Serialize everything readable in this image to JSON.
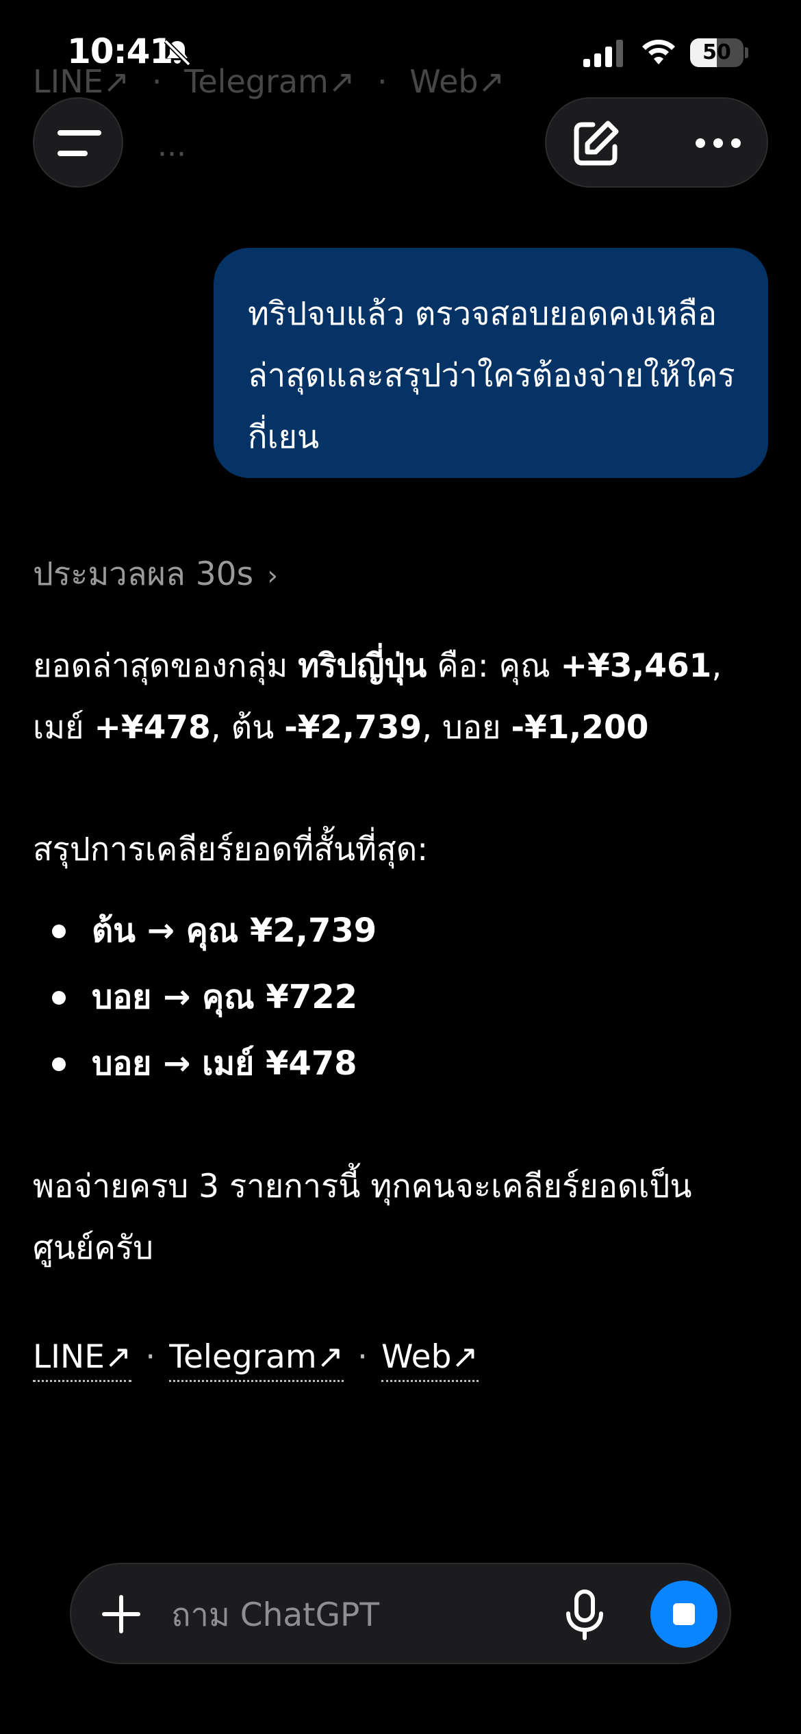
{
  "status_bar": {
    "time": "10:41",
    "battery_percent": 50,
    "battery_label": "50",
    "icons": [
      "bell-slash-icon",
      "cellular-signal-icon",
      "wifi-icon",
      "battery-icon"
    ]
  },
  "ghost_links": {
    "line": "LINE↗",
    "telegram": "Telegram↗",
    "web": "Web↗",
    "separator": "·",
    "more": "···"
  },
  "header": {
    "icons": [
      "menu-icon",
      "edit-icon",
      "more-dots-icon"
    ]
  },
  "user_message": {
    "text": "ทริปจบแล้ว ตรวจสอบยอดคงเหลือล่าสุดและสรุปว่าใครต้องจ่ายให้ใครกี่เยน",
    "bubble_color": "#053366"
  },
  "thinking": {
    "label": "ประมวลผล 30s",
    "chevron": "›"
  },
  "answer": {
    "p1_prefix": "ยอดล่าสุดของกลุ่ม ",
    "p1_group": "ทริปญี่ปุ่น",
    "p1_kue": " คือ: คุณ ",
    "p1_you_amount": "+¥3,461",
    "p1_comma1": ", ",
    "p1_may": "เมย์ ",
    "p1_may_amount": "+¥478",
    "p1_comma2": ", ต้น ",
    "p1_ton_amount": "-¥2,739",
    "p1_comma3": ", บอย ",
    "p1_boy_amount": "-¥1,200",
    "p2": "สรุปการเคลียร์ยอดที่สั้นที่สุด:",
    "transfers": [
      "ต้น → คุณ ¥2,739",
      "บอย → คุณ ¥722",
      "บอย → เมย์ ¥478"
    ],
    "p3": "พอจ่ายครบ 3 รายการนี้ ทุกคนจะเคลียร์ยอดเป็นศูนย์ครับ"
  },
  "links": {
    "line": "LINE↗",
    "telegram": "Telegram↗",
    "web": "Web↗",
    "separator": "·"
  },
  "composer": {
    "placeholder": "ถาม ChatGPT",
    "value": "",
    "icons": [
      "plus-icon",
      "microphone-icon",
      "stop-icon"
    ],
    "accent": "#0a84ff"
  }
}
